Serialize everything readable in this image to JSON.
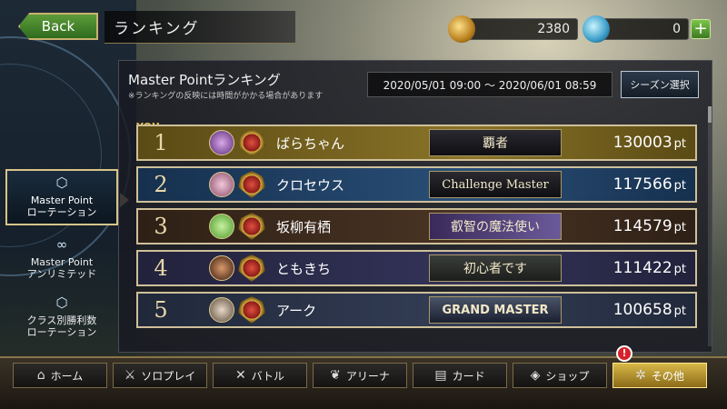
{
  "header": {
    "back_label": "Back",
    "page_title": "ランキング"
  },
  "currency": {
    "gold": "2380",
    "crystal": "0"
  },
  "side_tabs": [
    {
      "label": "Master Point\nローテーション",
      "active": true
    },
    {
      "label": "Master Point\nアンリミテッド",
      "active": false
    },
    {
      "label": "クラス別勝利数\nローテーション",
      "active": false
    }
  ],
  "panel": {
    "title": "Master Pointランキング",
    "note": "※ランキングの反映には時間がかかる場合があります",
    "period": "2020/05/01 09:00 〜 2020/06/01 08:59",
    "season_button": "シーズン選択",
    "you_label": "YOU"
  },
  "rankings": [
    {
      "rank": "1",
      "name": "ばらちゃん",
      "title": "覇者",
      "points": "130003",
      "unit": "pt"
    },
    {
      "rank": "2",
      "name": "クロセウス",
      "title": "Challenge Master",
      "points": "117566",
      "unit": "pt"
    },
    {
      "rank": "3",
      "name": "坂柳有栖",
      "title": "叡智の魔法使い",
      "points": "114579",
      "unit": "pt"
    },
    {
      "rank": "4",
      "name": "ともきち",
      "title": "初心者です",
      "points": "111422",
      "unit": "pt"
    },
    {
      "rank": "5",
      "name": "アーク",
      "title": "GRAND MASTER",
      "points": "100658",
      "unit": "pt"
    }
  ],
  "bottom_nav": [
    {
      "label": "ホーム",
      "icon": "home-icon"
    },
    {
      "label": "ソロプレイ",
      "icon": "solo-play-icon"
    },
    {
      "label": "バトル",
      "icon": "swords-icon"
    },
    {
      "label": "アリーナ",
      "icon": "arena-icon"
    },
    {
      "label": "カード",
      "icon": "cards-icon"
    },
    {
      "label": "ショップ",
      "icon": "shop-icon"
    },
    {
      "label": "その他",
      "icon": "other-icon",
      "active": true
    }
  ],
  "alert_badge": "!",
  "colors": {
    "row1": "#6b5a1c",
    "row2": "#1d3a5c",
    "row3": "#3a2a1e",
    "row4": "#2a2a48",
    "row5": "#2a3040",
    "accent_gold": "#d8c48a"
  }
}
